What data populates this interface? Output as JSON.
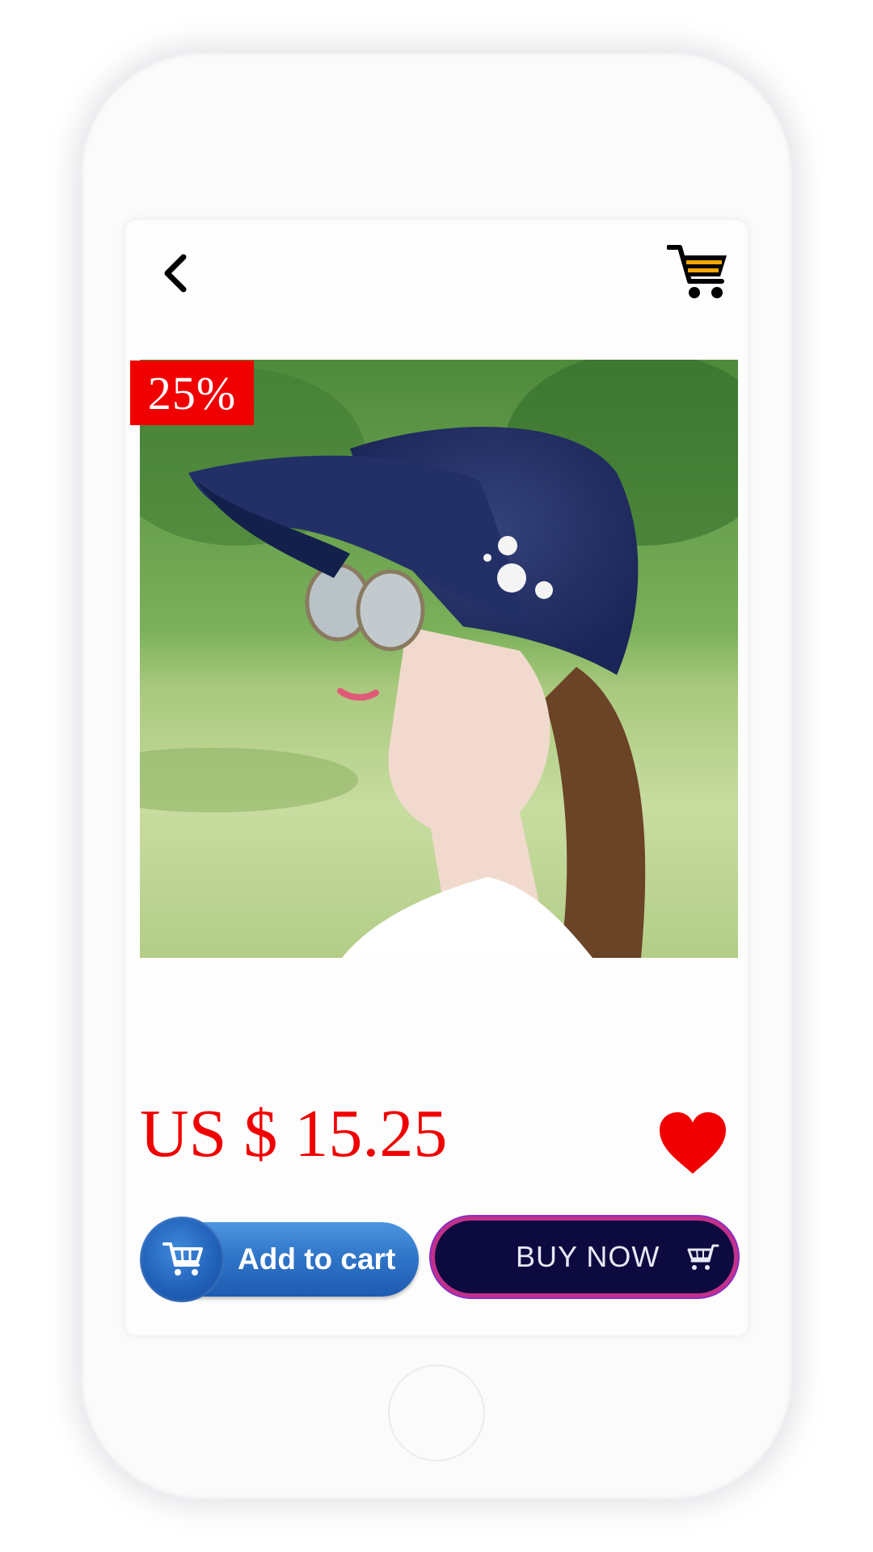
{
  "product": {
    "discount_badge": "25%",
    "price": "US $ 15.25",
    "image_icon": "product-photo-woman-in-navy-sun-visor-hat"
  },
  "header": {
    "back_icon": "chevron-left-icon",
    "cart_icon": "shopping-cart-icon"
  },
  "actions": {
    "add_to_cart_label": "Add to cart",
    "buy_now_label": "BUY NOW",
    "favorite_icon": "heart-icon"
  },
  "colors": {
    "price_red": "#f00000",
    "badge_red": "#f00000",
    "add_to_cart_blue": "#2f74c8",
    "buy_now_navy": "#0d0a40",
    "buy_now_border": "#c2308a"
  }
}
